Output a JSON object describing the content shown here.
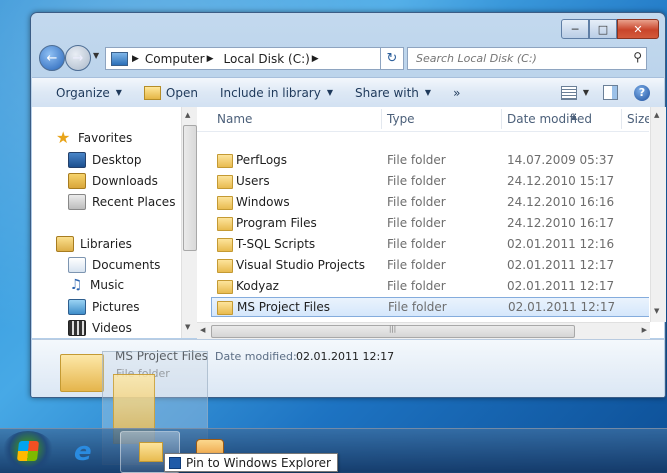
{
  "address": {
    "crumbs": [
      "Computer",
      "Local Disk (C:)"
    ]
  },
  "search": {
    "placeholder": "Search Local Disk (C:)"
  },
  "toolbar": {
    "organize": "Organize",
    "open": "Open",
    "include": "Include in library",
    "share": "Share with",
    "more": "»"
  },
  "nav": {
    "favorites": "Favorites",
    "desktop": "Desktop",
    "downloads": "Downloads",
    "recent": "Recent Places",
    "libraries": "Libraries",
    "documents": "Documents",
    "music": "Music",
    "pictures": "Pictures",
    "videos": "Videos"
  },
  "columns": {
    "name": "Name",
    "type": "Type",
    "date": "Date modified",
    "size": "Size"
  },
  "files": [
    {
      "name": "PerfLogs",
      "type": "File folder",
      "date": "14.07.2009 05:37"
    },
    {
      "name": "Users",
      "type": "File folder",
      "date": "24.12.2010 15:17"
    },
    {
      "name": "Windows",
      "type": "File folder",
      "date": "24.12.2010 16:16"
    },
    {
      "name": "Program Files",
      "type": "File folder",
      "date": "24.12.2010 16:17"
    },
    {
      "name": "T-SQL Scripts",
      "type": "File folder",
      "date": "02.01.2011 12:16"
    },
    {
      "name": "Visual Studio Projects",
      "type": "File folder",
      "date": "02.01.2011 12:17"
    },
    {
      "name": "Kodyaz",
      "type": "File folder",
      "date": "02.01.2011 12:17"
    },
    {
      "name": "MS Project Files",
      "type": "File folder",
      "date": "02.01.2011 12:17"
    }
  ],
  "details": {
    "name": "MS Project Files",
    "modified_label": "Date modified:",
    "modified": "02.01.2011 12:17",
    "type": "File folder"
  },
  "tooltip": "Pin to Windows Explorer",
  "icons": {
    "back": "back-arrow-icon",
    "forward": "forward-arrow-icon",
    "refresh": "refresh-icon",
    "search": "magnifier-icon",
    "help": "help-icon"
  }
}
